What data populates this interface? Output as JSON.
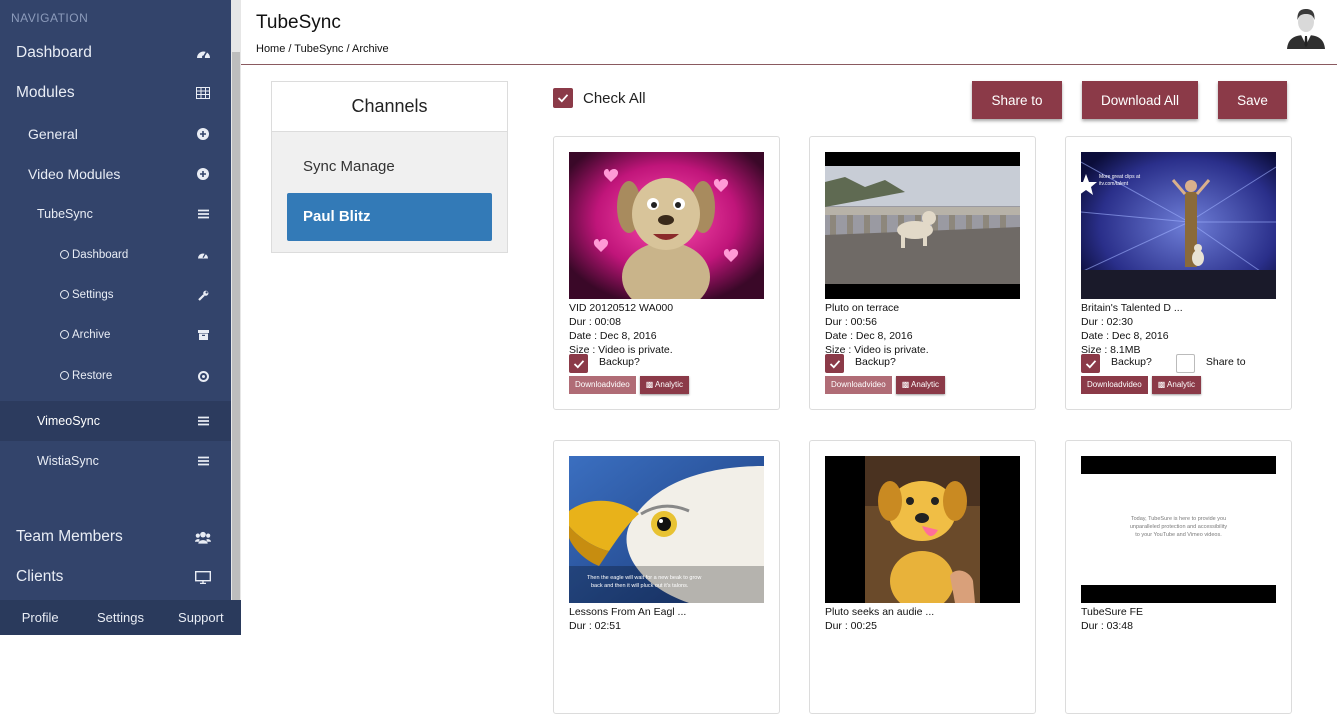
{
  "sidebar": {
    "heading": "NAVIGATION",
    "items": [
      {
        "label": "Dashboard",
        "icon": "dashboard-gauge-icon",
        "level": 0
      },
      {
        "label": "Modules",
        "icon": "table-grid-icon",
        "level": 0
      },
      {
        "label": "General",
        "icon": "plus-circle-icon",
        "level": 1
      },
      {
        "label": "Video Modules",
        "icon": "plus-circle-icon",
        "level": 1
      },
      {
        "label": "TubeSync",
        "icon": "menu-bars-icon",
        "level": 2
      },
      {
        "label": "Dashboard",
        "icon": "dashboard-gauge-icon",
        "level": 3
      },
      {
        "label": "Settings",
        "icon": "wrench-icon",
        "level": 3
      },
      {
        "label": "Archive",
        "icon": "archive-box-icon",
        "level": 3
      },
      {
        "label": "Restore",
        "icon": "restore-icon",
        "level": 3
      },
      {
        "label": "VimeoSync",
        "icon": "menu-bars-icon",
        "level": 2,
        "active": true
      },
      {
        "label": "WistiaSync",
        "icon": "menu-bars-icon",
        "level": 2
      },
      {
        "label": "Team Members",
        "icon": "users-icon",
        "level": 0
      },
      {
        "label": "Clients",
        "icon": "monitor-icon",
        "level": 0
      }
    ],
    "footer": [
      "Profile",
      "Settings",
      "Support"
    ]
  },
  "header": {
    "title": "TubeSync",
    "breadcrumb": "Home / TubeSync / Archive"
  },
  "channels": {
    "title": "Channels",
    "items": [
      "Sync Manage",
      "Paul Blitz"
    ],
    "selected": "Paul Blitz"
  },
  "toolbar": {
    "check_all_label": "Check All",
    "share_label": "Share to",
    "download_all_label": "Download All",
    "save_label": "Save"
  },
  "videos": [
    {
      "title": "VID 20120512 WA000",
      "dur": "Dur : 00:08",
      "date": "Date : Dec 8, 2016",
      "size": "Size : Video is private.",
      "backup_label": "Backup?",
      "backup_checked": true,
      "download_label": "Downloadvideo",
      "analytic_label": "Analytic",
      "download_active": false,
      "thumb": "dog-hearts"
    },
    {
      "title": "Pluto on terrace",
      "dur": "Dur : 00:56",
      "date": "Date : Dec 8, 2016",
      "size": "Size : Video is private.",
      "backup_label": "Backup?",
      "backup_checked": true,
      "download_label": "Downloadvideo",
      "analytic_label": "Analytic",
      "download_active": false,
      "thumb": "terrace"
    },
    {
      "title": "Britain's Talented D ...",
      "dur": "Dur : 02:30",
      "date": "Date : Dec 8, 2016",
      "size": "Size : 8.1MB",
      "backup_label": "Backup?",
      "backup_checked": true,
      "share_label": "Share to",
      "share_checked": false,
      "download_label": "Downloadvideo",
      "analytic_label": "Analytic",
      "download_active": true,
      "thumb": "stage"
    },
    {
      "title": "Lessons From An Eagl ...",
      "dur": "Dur : 02:51",
      "thumb": "eagle"
    },
    {
      "title": "Pluto seeks an audie ...",
      "dur": "Dur : 00:25",
      "thumb": "puppy"
    },
    {
      "title": "TubeSure FE",
      "dur": "Dur : 03:48",
      "thumb": "text-slide",
      "thumb_text": [
        "Today, TubeSure is here to provide you",
        "unparalleled protection and accessibility",
        "to your YouTube and Vimeo videos."
      ]
    }
  ],
  "colors": {
    "sidebar_bg": "#33446b",
    "accent": "#8b3a48",
    "selected_channel": "#337ab7"
  }
}
